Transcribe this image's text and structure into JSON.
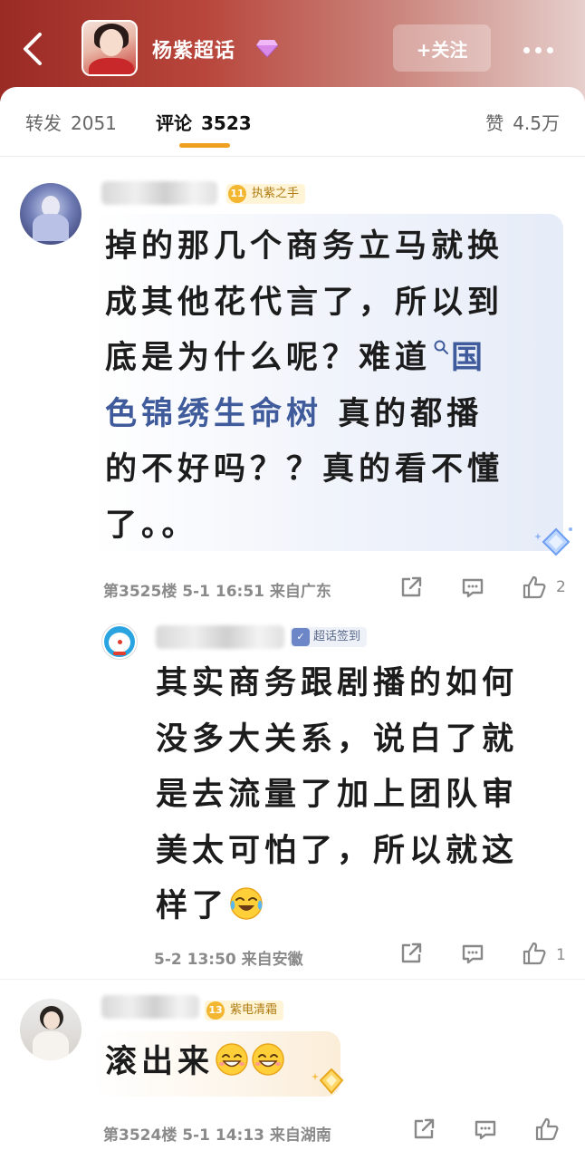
{
  "header": {
    "title": "杨紫超话",
    "follow_label": "+关注"
  },
  "tabs": {
    "repost_label": "转发",
    "repost_count": "2051",
    "comment_label": "评论",
    "comment_count": "3523",
    "like_label": "赞",
    "like_count": "4.5万"
  },
  "comments": [
    {
      "badge_level": "11",
      "badge_text": "执紫之手",
      "text_lines": [
        "掉的那几个商务立马就换",
        "成其他花代言了，所以到",
        "底是为什么呢？难道"
      ],
      "topic_link_a": "国",
      "topic_link_b": "色锦绣生命树",
      "text_after_topic": " 真的都播",
      "text_tail": [
        "的不好吗？？真的看不懂",
        "了。。"
      ],
      "meta": "第3525楼 5-1 16:51 来自广东",
      "likes": "2"
    },
    {
      "badge_text": "超话签到",
      "text_lines": [
        "其实商务跟剧播的如何",
        "没多大关系，说白了就",
        "是去流量了加上团队审",
        "美太可怕了，所以就这"
      ],
      "text_last": "样了",
      "meta": "5-2 13:50 来自安徽",
      "likes": "1"
    },
    {
      "badge_level": "13",
      "badge_text": "紫电清霜",
      "text": "滚出来",
      "meta": "第3524楼 5-1 14:13 来自湖南"
    }
  ],
  "icons": {
    "back": "back-arrow-icon",
    "more": "more-dots-icon",
    "share": "share-icon",
    "comment": "comment-icon",
    "like": "thumbs-up-icon"
  },
  "colors": {
    "header_red": "#9a2a24",
    "tab_accent": "#f0a020",
    "topic_link": "#3f5b9c",
    "badge_gold": "#f2b631"
  }
}
